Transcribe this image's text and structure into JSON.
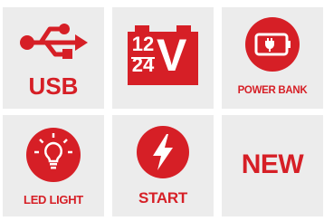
{
  "tiles": {
    "usb": {
      "label": "USB",
      "icon": "usb-icon"
    },
    "voltage": {
      "line1": "12",
      "line2": "24",
      "unit": "V",
      "icon": "car-battery-icon"
    },
    "power_bank": {
      "label": "POWER BANK",
      "icon": "power-bank-icon"
    },
    "led_light": {
      "label": "LED LIGHT",
      "icon": "light-bulb-icon"
    },
    "start": {
      "label": "START",
      "icon": "lightning-icon"
    },
    "new": {
      "label": "NEW"
    }
  },
  "colors": {
    "accent": "#d61f26",
    "tile_background": "#ececec",
    "page_background": "#ffffff"
  }
}
